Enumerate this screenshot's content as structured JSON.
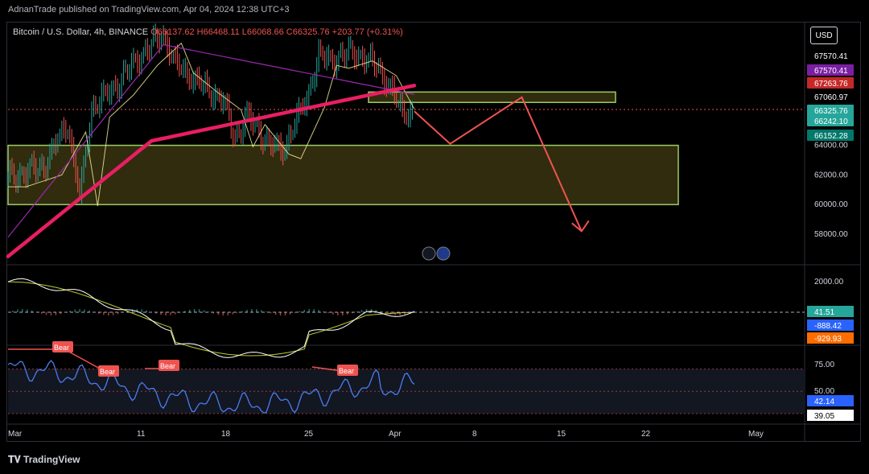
{
  "header": {
    "publisher": "AdnanTrade published on TradingView.com, Apr 04, 2024 12:38 UTC+3"
  },
  "legend": {
    "symbol": "Bitcoin / U.S. Dollar, 4h, BINANCE",
    "ohlc": "O66137.62 H66468.11 L66068.66 C66325.76 +203.77 (+0.31%)"
  },
  "currency_button": "USD",
  "footer": {
    "brand": "TradingView"
  },
  "chart_data": [
    {
      "type": "line",
      "name": "price",
      "price_axis_ticks": [
        "64000.00",
        "62000.00",
        "60000.00",
        "58000.00"
      ],
      "price_tags": [
        {
          "label": "67570.41",
          "value": 67570.41,
          "bg": "#000000",
          "fg": "#ffffff"
        },
        {
          "label": "67570.41",
          "value": 67570.41,
          "bg": "#7b1fa2",
          "fg": "#ffffff"
        },
        {
          "label": "67263.76",
          "value": 67263.76,
          "bg": "#c62828",
          "fg": "#ffffff"
        },
        {
          "label": "67060.97",
          "value": 67060.97,
          "bg": "#000000",
          "fg": "#ffffff"
        },
        {
          "label": "66325.76",
          "value": 66325.76,
          "bg": "#26a69a",
          "fg": "#ffffff"
        },
        {
          "label": "66242.10",
          "value": 66242.1,
          "bg": "#26a69a",
          "fg": "#ffffff"
        },
        {
          "label": "66152.28",
          "value": 66152.28,
          "bg": "#00796b",
          "fg": "#ffffff"
        }
      ],
      "zones": [
        {
          "name": "resistance",
          "from": 66900,
          "to": 67600,
          "color": "#fffa9e"
        },
        {
          "name": "support",
          "from": 60000,
          "to": 64000,
          "color": "#fffa9e"
        }
      ],
      "projection": [
        {
          "date": "Apr 04",
          "value": 66300
        },
        {
          "date": "Apr 07",
          "value": 64100
        },
        {
          "date": "Apr 13",
          "value": 67250
        },
        {
          "date": "Apr 18",
          "value": 58200
        }
      ],
      "colors": {
        "up": "#26a69a",
        "down": "#ef5350",
        "ma_red": "#e91e63",
        "ma_purple": "#9c27b0",
        "projection": "#ef5350"
      }
    },
    {
      "type": "line",
      "name": "macd",
      "axis_ticks": [
        "2000.00"
      ],
      "tags": [
        {
          "label": "41.51",
          "value": 41.51,
          "bg": "#26a69a"
        },
        {
          "label": "-888.42",
          "value": -888.42,
          "bg": "#2962ff"
        },
        {
          "label": "-929.93",
          "value": -929.93,
          "bg": "#ff6d00"
        }
      ]
    },
    {
      "type": "line",
      "name": "rsi",
      "axis_ticks": [
        "75.00",
        "50.00"
      ],
      "levels": [
        75,
        50,
        25
      ],
      "tags": [
        {
          "label": "42.14",
          "value": 42.14,
          "bg": "#2962ff",
          "fg": "#ffffff"
        },
        {
          "label": "39.05",
          "value": 39.05,
          "bg": "#ffffff",
          "fg": "#000000"
        }
      ],
      "divergence_labels": [
        "Bear",
        "Bear",
        "Bear",
        "Bear"
      ]
    }
  ],
  "x_axis": {
    "ticks": [
      "Mar",
      "11",
      "18",
      "25",
      "Apr",
      "8",
      "15",
      "22",
      "May"
    ]
  }
}
